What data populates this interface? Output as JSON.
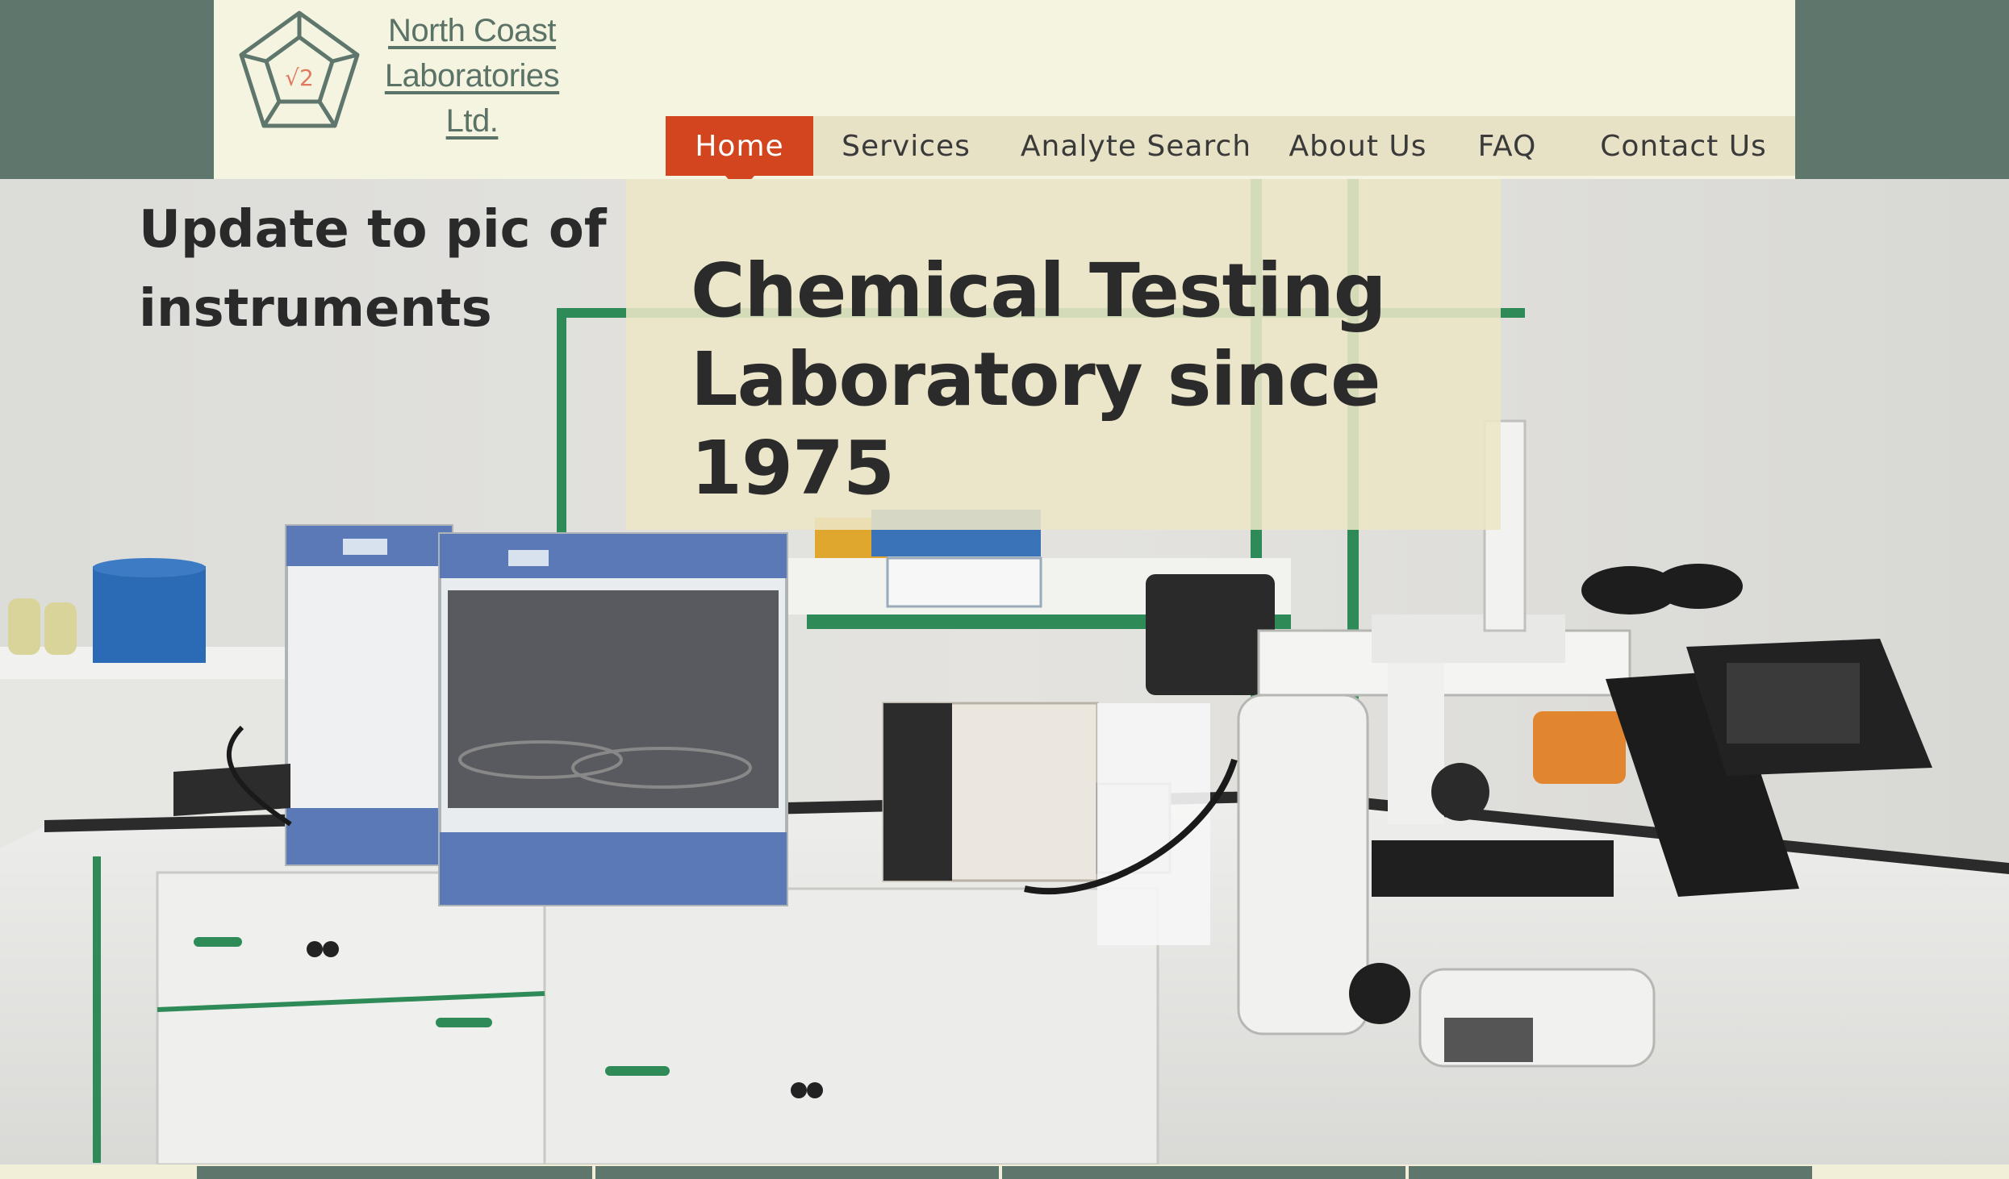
{
  "header": {
    "logo_symbol": "√2",
    "brand_lines": [
      "North Coast",
      "Laboratories",
      "Ltd."
    ]
  },
  "nav": {
    "items": [
      {
        "label": "Home",
        "active": true
      },
      {
        "label": "Services",
        "active": false
      },
      {
        "label": "Analyte Search",
        "active": false
      },
      {
        "label": "About Us",
        "active": false
      },
      {
        "label": "FAQ",
        "active": false
      },
      {
        "label": "Contact Us",
        "active": false
      }
    ]
  },
  "hero": {
    "note": "Update to pic of instruments",
    "title": "Chemical Testing Laboratory since 1975"
  },
  "colors": {
    "band": "#5f766c",
    "header_bg": "#f4f4e1",
    "nav_bg": "#e7e2c5",
    "nav_active": "#d2451f",
    "logo_accent": "#e07a5f"
  }
}
